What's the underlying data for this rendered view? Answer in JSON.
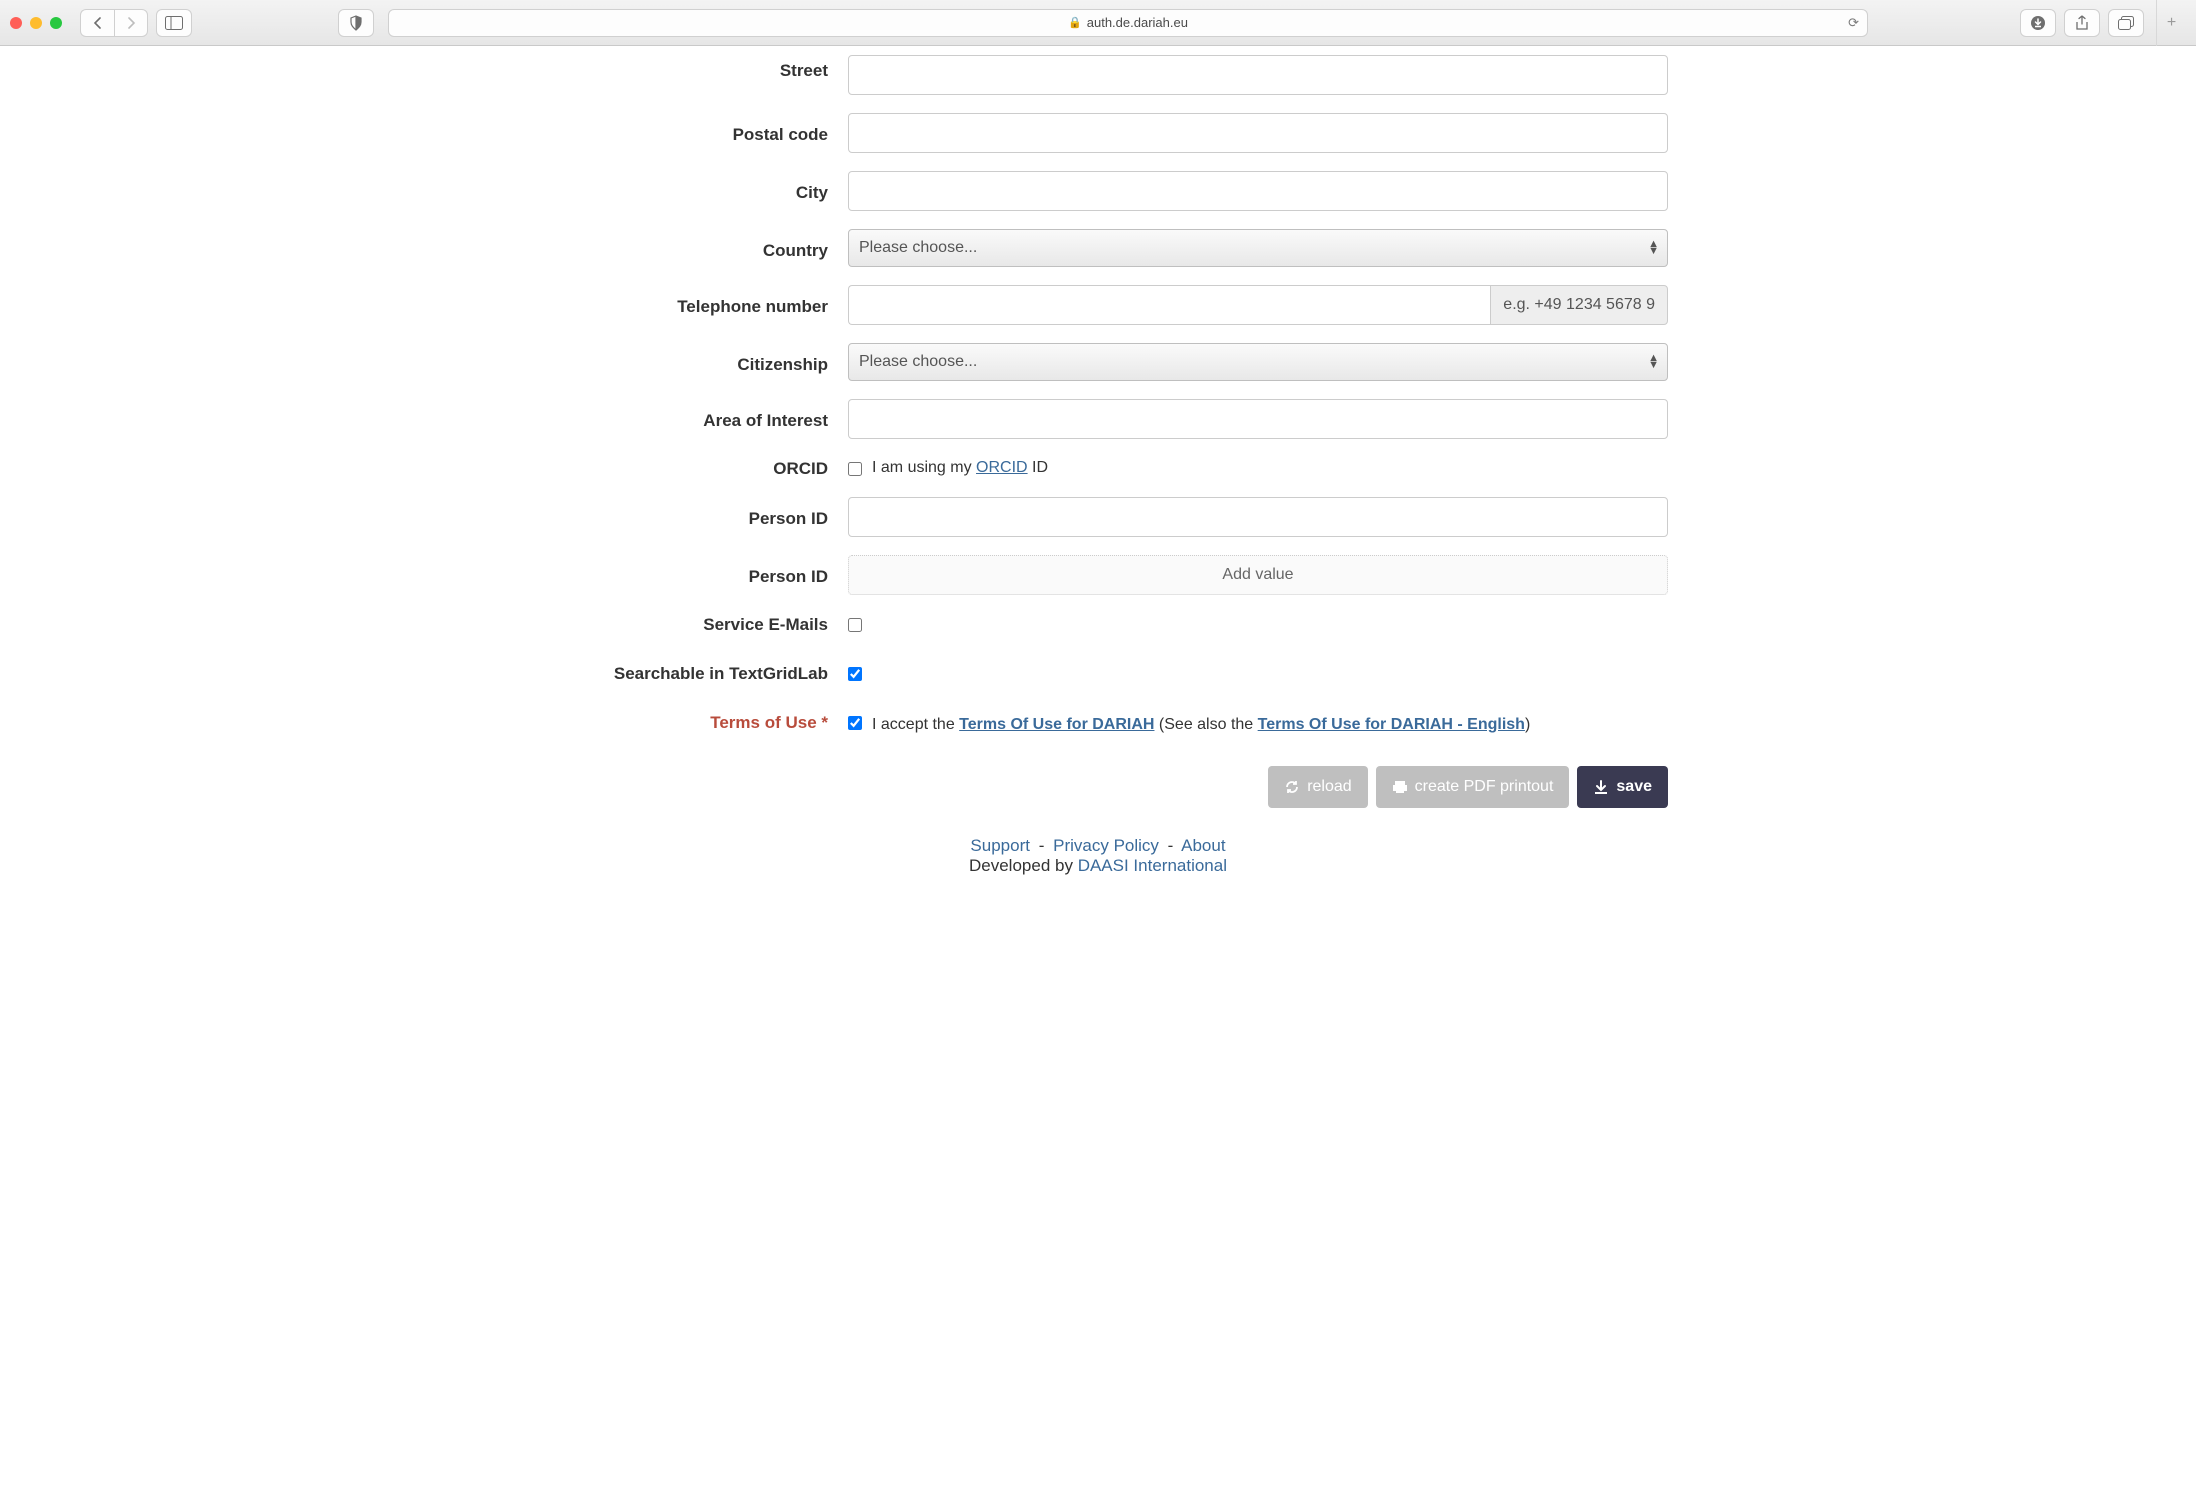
{
  "browser": {
    "url": "auth.de.dariah.eu"
  },
  "form": {
    "street": {
      "label": "Street",
      "value": ""
    },
    "postal": {
      "label": "Postal code",
      "value": ""
    },
    "city": {
      "label": "City",
      "value": ""
    },
    "country": {
      "label": "Country",
      "placeholder": "Please choose..."
    },
    "phone": {
      "label": "Telephone number",
      "value": "",
      "hint": "e.g. +49 1234 5678 9"
    },
    "citizenship": {
      "label": "Citizenship",
      "placeholder": "Please choose..."
    },
    "interest": {
      "label": "Area of Interest",
      "value": ""
    },
    "orcid": {
      "label": "ORCID",
      "pre": "I am using my ",
      "link": "ORCID",
      "post": " ID"
    },
    "personid1": {
      "label": "Person ID",
      "value": ""
    },
    "personid2": {
      "label": "Person ID",
      "add": "Add value"
    },
    "service_emails": {
      "label": "Service E-Mails"
    },
    "searchable": {
      "label": "Searchable in TextGridLab"
    },
    "terms": {
      "label": "Terms of Use *",
      "pre": "I accept the ",
      "link1": "Terms Of Use for DARIAH",
      "mid": " (See also the ",
      "link2": "Terms Of Use for DARIAH - English",
      "post": ")"
    }
  },
  "buttons": {
    "reload": "reload",
    "pdf": "create PDF printout",
    "save": "save"
  },
  "footer": {
    "support": "Support",
    "privacy": "Privacy Policy",
    "about": "About",
    "dev_pre": "Developed by ",
    "dev_link": "DAASI International"
  }
}
